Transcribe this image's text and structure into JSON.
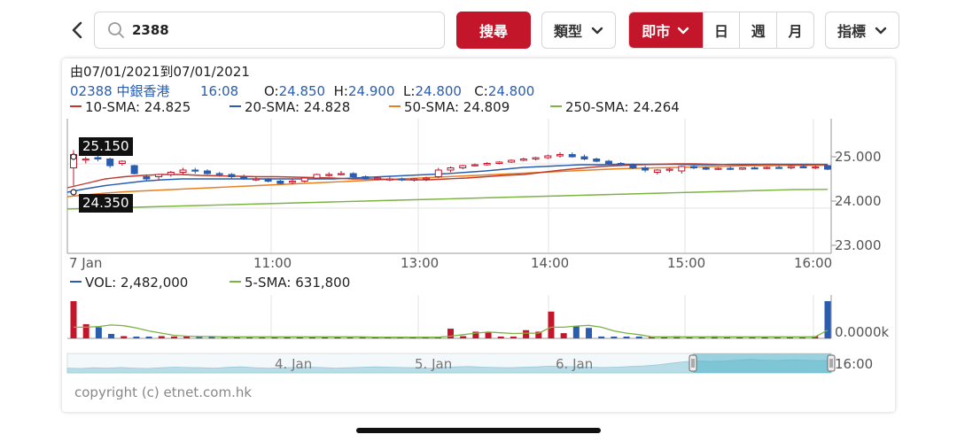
{
  "toolbar": {
    "search_value": "2388",
    "search_label": "搜尋",
    "type_label": "類型",
    "periods": {
      "intraday": "即市",
      "day": "日",
      "week": "週",
      "month": "月"
    },
    "indicator_label": "指標"
  },
  "chart_header": {
    "date_range": "由07/01/2021到07/01/2021",
    "symbol": "02388 中銀香港",
    "time": "16:08",
    "open_label": "O:",
    "open": "24.850",
    "high_label": "H:",
    "high": "24.900",
    "low_label": "L:",
    "low": "24.800",
    "close_label": "C:",
    "close": "24.800"
  },
  "price_legend": [
    {
      "text": "10-SMA: 24.825",
      "color": "#c0392b"
    },
    {
      "text": "20-SMA: 24.828",
      "color": "#2a5db0"
    },
    {
      "text": "50-SMA: 24.809",
      "color": "#e67e22"
    },
    {
      "text": "250-SMA: 24.264",
      "color": "#7cb342"
    }
  ],
  "volume_legend": [
    {
      "text": "VOL: 2,482,000",
      "color": "#2a5db0"
    },
    {
      "text": "5-SMA: 631,800",
      "color": "#7cb342"
    }
  ],
  "price_labels": {
    "high_box": "25.150",
    "low_box": "24.350"
  },
  "y_axis": [
    "25.000",
    "24.000",
    "23.000"
  ],
  "volume_axis": "0.0000k",
  "x_axis": [
    "7 Jan",
    "11:00",
    "13:00",
    "14:00",
    "15:00",
    "16:00"
  ],
  "navigator_labels": [
    "4. Jan",
    "5. Jan",
    "6. Jan",
    "16:00"
  ],
  "copyright": "copyright (c) etnet.com.hk",
  "chart_data": {
    "type": "candlestick",
    "y_range": [
      22.8,
      25.6
    ],
    "candles": [
      {
        "o": 24.75,
        "h": 25.15,
        "l": 24.35,
        "c": 25.05
      },
      {
        "o": 24.95,
        "h": 25.0,
        "l": 24.85,
        "c": 24.95
      },
      {
        "o": 24.98,
        "h": 25.02,
        "l": 24.9,
        "c": 24.95
      },
      {
        "o": 24.95,
        "h": 24.98,
        "l": 24.75,
        "c": 24.8
      },
      {
        "o": 24.85,
        "h": 24.92,
        "l": 24.8,
        "c": 24.9
      },
      {
        "o": 24.8,
        "h": 24.82,
        "l": 24.6,
        "c": 24.62
      },
      {
        "o": 24.55,
        "h": 24.6,
        "l": 24.45,
        "c": 24.5
      },
      {
        "o": 24.55,
        "h": 24.62,
        "l": 24.48,
        "c": 24.6
      },
      {
        "o": 24.6,
        "h": 24.68,
        "l": 24.55,
        "c": 24.65
      },
      {
        "o": 24.65,
        "h": 24.75,
        "l": 24.6,
        "c": 24.7
      },
      {
        "o": 24.7,
        "h": 24.75,
        "l": 24.62,
        "c": 24.68
      },
      {
        "o": 24.68,
        "h": 24.72,
        "l": 24.6,
        "c": 24.62
      },
      {
        "o": 24.62,
        "h": 24.66,
        "l": 24.55,
        "c": 24.6
      },
      {
        "o": 24.6,
        "h": 24.63,
        "l": 24.5,
        "c": 24.55
      },
      {
        "o": 24.55,
        "h": 24.6,
        "l": 24.48,
        "c": 24.5
      },
      {
        "o": 24.5,
        "h": 24.55,
        "l": 24.45,
        "c": 24.5
      },
      {
        "o": 24.5,
        "h": 24.52,
        "l": 24.42,
        "c": 24.45
      },
      {
        "o": 24.45,
        "h": 24.48,
        "l": 24.38,
        "c": 24.4
      },
      {
        "o": 24.42,
        "h": 24.5,
        "l": 24.38,
        "c": 24.45
      },
      {
        "o": 24.45,
        "h": 24.55,
        "l": 24.42,
        "c": 24.52
      },
      {
        "o": 24.52,
        "h": 24.62,
        "l": 24.5,
        "c": 24.6
      },
      {
        "o": 24.6,
        "h": 24.65,
        "l": 24.55,
        "c": 24.6
      },
      {
        "o": 24.6,
        "h": 24.68,
        "l": 24.58,
        "c": 24.62
      },
      {
        "o": 24.62,
        "h": 24.65,
        "l": 24.52,
        "c": 24.55
      },
      {
        "o": 24.55,
        "h": 24.58,
        "l": 24.48,
        "c": 24.5
      },
      {
        "o": 24.5,
        "h": 24.55,
        "l": 24.48,
        "c": 24.52
      },
      {
        "o": 24.5,
        "h": 24.55,
        "l": 24.45,
        "c": 24.5
      },
      {
        "o": 24.5,
        "h": 24.53,
        "l": 24.45,
        "c": 24.48
      },
      {
        "o": 24.48,
        "h": 24.52,
        "l": 24.44,
        "c": 24.5
      },
      {
        "o": 24.5,
        "h": 24.55,
        "l": 24.45,
        "c": 24.52
      },
      {
        "o": 24.55,
        "h": 24.75,
        "l": 24.52,
        "c": 24.7
      },
      {
        "o": 24.7,
        "h": 24.78,
        "l": 24.65,
        "c": 24.75
      },
      {
        "o": 24.75,
        "h": 24.82,
        "l": 24.72,
        "c": 24.8
      },
      {
        "o": 24.8,
        "h": 24.85,
        "l": 24.78,
        "c": 24.82
      },
      {
        "o": 24.82,
        "h": 24.88,
        "l": 24.8,
        "c": 24.85
      },
      {
        "o": 24.85,
        "h": 24.9,
        "l": 24.83,
        "c": 24.88
      },
      {
        "o": 24.88,
        "h": 24.94,
        "l": 24.86,
        "c": 24.92
      },
      {
        "o": 24.92,
        "h": 24.98,
        "l": 24.9,
        "c": 24.95
      },
      {
        "o": 24.95,
        "h": 25.0,
        "l": 24.92,
        "c": 24.98
      },
      {
        "o": 24.98,
        "h": 25.05,
        "l": 24.95,
        "c": 25.02
      },
      {
        "o": 25.02,
        "h": 25.1,
        "l": 24.98,
        "c": 25.05
      },
      {
        "o": 25.05,
        "h": 25.1,
        "l": 24.98,
        "c": 25.0
      },
      {
        "o": 25.0,
        "h": 25.05,
        "l": 24.92,
        "c": 24.95
      },
      {
        "o": 24.95,
        "h": 24.98,
        "l": 24.88,
        "c": 24.9
      },
      {
        "o": 24.9,
        "h": 24.93,
        "l": 24.83,
        "c": 24.85
      },
      {
        "o": 24.85,
        "h": 24.88,
        "l": 24.8,
        "c": 24.82
      },
      {
        "o": 24.82,
        "h": 24.85,
        "l": 24.72,
        "c": 24.75
      },
      {
        "o": 24.75,
        "h": 24.8,
        "l": 24.65,
        "c": 24.7
      },
      {
        "o": 24.65,
        "h": 24.72,
        "l": 24.6,
        "c": 24.7
      },
      {
        "o": 24.7,
        "h": 24.75,
        "l": 24.65,
        "c": 24.72
      },
      {
        "o": 24.68,
        "h": 24.8,
        "l": 24.62,
        "c": 24.78
      },
      {
        "o": 24.78,
        "h": 24.8,
        "l": 24.72,
        "c": 24.75
      },
      {
        "o": 24.75,
        "h": 24.78,
        "l": 24.7,
        "c": 24.72
      },
      {
        "o": 24.72,
        "h": 24.76,
        "l": 24.7,
        "c": 24.74
      },
      {
        "o": 24.74,
        "h": 24.78,
        "l": 24.7,
        "c": 24.72
      },
      {
        "o": 24.72,
        "h": 24.76,
        "l": 24.7,
        "c": 24.75
      },
      {
        "o": 24.75,
        "h": 24.78,
        "l": 24.72,
        "c": 24.74
      },
      {
        "o": 24.74,
        "h": 24.78,
        "l": 24.72,
        "c": 24.76
      },
      {
        "o": 24.76,
        "h": 24.8,
        "l": 24.74,
        "c": 24.75
      },
      {
        "o": 24.75,
        "h": 24.8,
        "l": 24.72,
        "c": 24.78
      },
      {
        "o": 24.78,
        "h": 24.82,
        "l": 24.74,
        "c": 24.75
      },
      {
        "o": 24.75,
        "h": 24.8,
        "l": 24.72,
        "c": 24.77
      },
      {
        "o": 24.8,
        "h": 24.82,
        "l": 24.7,
        "c": 24.72
      }
    ],
    "volume": [
      1.0,
      0.38,
      0.3,
      0.12,
      0.06,
      0.04,
      0.03,
      0.06,
      0.05,
      0.04,
      0.04,
      0.03,
      0.04,
      0.03,
      0.02,
      0.04,
      0.03,
      0.04,
      0.03,
      0.02,
      0.03,
      0.04,
      0.03,
      0.02,
      0.03,
      0.02,
      0.03,
      0.02,
      0.03,
      0.02,
      0.26,
      0.06,
      0.18,
      0.18,
      0.03,
      0.02,
      0.22,
      0.18,
      0.72,
      0.14,
      0.32,
      0.28,
      0.05,
      0.03,
      0.02,
      0.03,
      0.02,
      0.05,
      0.06,
      0.03,
      0.02,
      0.06,
      0.03,
      0.02,
      0.05,
      0.03,
      0.02,
      0.03,
      0.02,
      0.06,
      1.0
    ],
    "vol_sma_5": [
      0.3,
      0.3,
      0.32,
      0.36,
      0.34,
      0.28,
      0.2,
      0.14,
      0.08,
      0.06,
      0.05,
      0.05,
      0.04,
      0.04,
      0.04,
      0.04,
      0.04,
      0.04,
      0.04,
      0.04,
      0.04,
      0.04,
      0.04,
      0.04,
      0.03,
      0.03,
      0.03,
      0.03,
      0.03,
      0.03,
      0.06,
      0.1,
      0.14,
      0.17,
      0.15,
      0.13,
      0.14,
      0.14,
      0.3,
      0.3,
      0.33,
      0.35,
      0.3,
      0.2,
      0.14,
      0.1,
      0.04,
      0.04,
      0.04,
      0.04,
      0.04,
      0.04,
      0.04,
      0.04,
      0.04,
      0.04,
      0.04,
      0.04,
      0.04,
      0.04,
      0.22
    ],
    "sma_10": [
      24.3,
      24.4,
      24.5,
      24.55,
      24.58,
      24.6,
      24.6,
      24.58,
      24.57,
      24.56,
      24.55,
      24.55,
      24.54,
      24.53,
      24.52,
      24.5,
      24.5,
      24.49,
      24.48,
      24.48,
      24.5,
      24.52,
      24.55,
      24.58,
      24.6,
      24.65,
      24.7,
      24.74,
      24.78,
      24.8,
      24.82,
      24.83,
      24.84,
      24.84,
      24.83,
      24.82,
      24.82,
      24.83,
      24.82,
      24.82,
      24.825
    ],
    "sma_20": [
      24.2,
      24.28,
      24.35,
      24.4,
      24.45,
      24.48,
      24.5,
      24.5,
      24.5,
      24.5,
      24.5,
      24.5,
      24.5,
      24.5,
      24.5,
      24.52,
      24.54,
      24.56,
      24.58,
      24.6,
      24.62,
      24.65,
      24.68,
      24.72,
      24.76,
      24.78,
      24.8,
      24.82,
      24.82,
      24.83,
      24.83,
      24.83,
      24.83,
      24.82,
      24.82,
      24.83,
      24.83,
      24.83,
      24.83,
      24.83,
      24.828
    ],
    "sma_50": [
      24.1,
      24.14,
      24.18,
      24.21,
      24.23,
      24.25,
      24.27,
      24.29,
      24.31,
      24.33,
      24.35,
      24.37,
      24.39,
      24.41,
      24.43,
      24.45,
      24.47,
      24.49,
      24.51,
      24.53,
      24.55,
      24.57,
      24.59,
      24.61,
      24.63,
      24.65,
      24.67,
      24.69,
      24.71,
      24.73,
      24.74,
      24.75,
      24.76,
      24.77,
      24.78,
      24.79,
      24.8,
      24.8,
      24.81,
      24.81,
      24.809
    ],
    "sma_250": [
      23.82,
      23.84,
      23.86,
      23.88,
      23.9,
      23.92,
      23.94,
      23.96,
      23.98,
      24.0,
      24.02,
      24.04,
      24.06,
      24.08,
      24.1,
      24.12,
      24.14,
      24.16,
      24.18,
      24.2,
      24.22,
      24.24,
      24.26,
      24.264
    ],
    "navigator_series": [
      0.3,
      0.28,
      0.32,
      0.3,
      0.34,
      0.3,
      0.28,
      0.32,
      0.36,
      0.34,
      0.32,
      0.3,
      0.35,
      0.38,
      0.33,
      0.3,
      0.32,
      0.34,
      0.36,
      0.34,
      0.3,
      0.32,
      0.35,
      0.38,
      0.36,
      0.34,
      0.32,
      0.3,
      0.34,
      0.38,
      0.4,
      0.36,
      0.34,
      0.32,
      0.35,
      0.38,
      0.42,
      0.4,
      0.38,
      0.36,
      0.34,
      0.36,
      0.4,
      0.44,
      0.5,
      0.6,
      0.7,
      0.75,
      0.72,
      0.74,
      0.8,
      0.85,
      0.8,
      0.78,
      0.82,
      0.8,
      0.76,
      0.8
    ]
  },
  "colors": {
    "up": "#c4162b",
    "down": "#2a5db0",
    "accent": "#c4162b",
    "navigator": "#b8dde6",
    "navigator_sel": "#4fb1c6"
  }
}
